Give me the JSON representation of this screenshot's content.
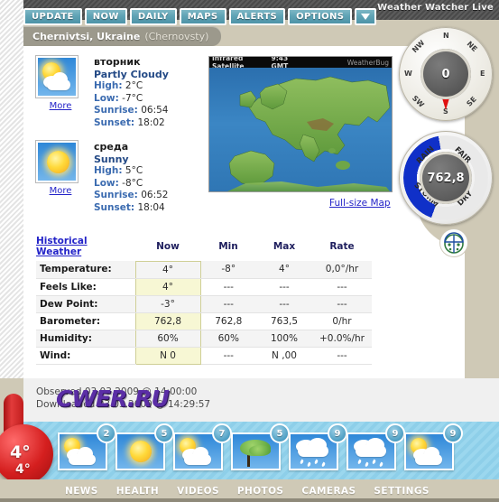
{
  "window": {
    "brand": "Weather Watcher Live"
  },
  "toolbar": {
    "buttons": [
      {
        "label": "UPDATE",
        "name": "update"
      },
      {
        "label": "NOW",
        "name": "now"
      },
      {
        "label": "DAILY",
        "name": "daily"
      },
      {
        "label": "MAPS",
        "name": "maps"
      },
      {
        "label": "ALERTS",
        "name": "alerts"
      },
      {
        "label": "OPTIONS",
        "name": "options"
      }
    ],
    "dropdown_icon": "chevron-down-icon"
  },
  "location": {
    "city": "Chernivtsi, Ukraine",
    "alt_name": "(Chernovsty)"
  },
  "forecast_cards": [
    {
      "day": "вторник",
      "condition": "Partly Cloudy",
      "icon": "partly-cloudy-icon",
      "high_label": "High:",
      "high": "2°C",
      "low_label": "Low:",
      "low": "-7°C",
      "sunrise_label": "Sunrise:",
      "sunrise": "06:54",
      "sunset_label": "Sunset:",
      "sunset": "18:02",
      "more": "More"
    },
    {
      "day": "среда",
      "condition": "Sunny",
      "icon": "sunny-icon",
      "high_label": "High:",
      "high": "5°C",
      "low_label": "Low:",
      "low": "-8°C",
      "sunrise_label": "Sunrise:",
      "sunrise": "06:52",
      "sunset_label": "Sunset:",
      "sunset": "18:04",
      "more": "More"
    }
  ],
  "map": {
    "title": "Infrared Satellite",
    "time": "9:43 GMT",
    "watermark": "WeatherBug",
    "fullsize_link": "Full-size Map"
  },
  "table": {
    "headers": [
      "Historical Weather",
      "Now",
      "Min",
      "Max",
      "Rate"
    ],
    "rows": [
      {
        "label": "Temperature:",
        "now": "4°",
        "min": "-8°",
        "max": "4°",
        "rate": "0,0°/hr"
      },
      {
        "label": "Feels Like:",
        "now": "4°",
        "min": "---",
        "max": "---",
        "rate": "---"
      },
      {
        "label": "Dew Point:",
        "now": "-3°",
        "min": "---",
        "max": "---",
        "rate": "---"
      },
      {
        "label": "Barometer:",
        "now": "762,8",
        "min": "762,8",
        "max": "763,5",
        "rate": "0/hr"
      },
      {
        "label": "Humidity:",
        "now": "60%",
        "min": "60%",
        "max": "100%",
        "rate": "+0.0%/hr"
      },
      {
        "label": "Wind:",
        "now": "N 0",
        "min": "---",
        "max": "N ,00",
        "rate": "---"
      }
    ]
  },
  "compass": {
    "value": "0",
    "directions": [
      "N",
      "NE",
      "E",
      "SE",
      "S",
      "SW",
      "W",
      "NW"
    ],
    "needle_direction": "S"
  },
  "barometer": {
    "value": "762,8",
    "labels": [
      "RAIN",
      "FAIR",
      "DRY",
      "STORM"
    ],
    "arc_color": "#1030c8"
  },
  "pollen_icon": "ladybug-icon",
  "observed": {
    "observed_line": "Observed 03.03.2009 @ 14:00:00",
    "downloaded_line": "Downloaded 03.03.2009 @ 14:29:57",
    "watermark": "CWER.RU"
  },
  "strip": {
    "items": [
      {
        "temp": "2",
        "icon": "partly-cloudy-icon"
      },
      {
        "temp": "5",
        "icon": "sunny-icon"
      },
      {
        "temp": "7",
        "icon": "partly-cloudy-icon"
      },
      {
        "temp": "5",
        "icon": "windy-tree-icon"
      },
      {
        "temp": "9",
        "icon": "rain-icon"
      },
      {
        "temp": "9",
        "icon": "rain-icon"
      },
      {
        "temp": "9",
        "icon": "partly-cloudy-icon"
      }
    ]
  },
  "thermometer": {
    "primary": "4°",
    "secondary": "4°"
  },
  "bottom_nav": [
    "NEWS",
    "HEALTH",
    "VIDEOS",
    "PHOTOS",
    "CAMERAS",
    "SETTINGS"
  ]
}
